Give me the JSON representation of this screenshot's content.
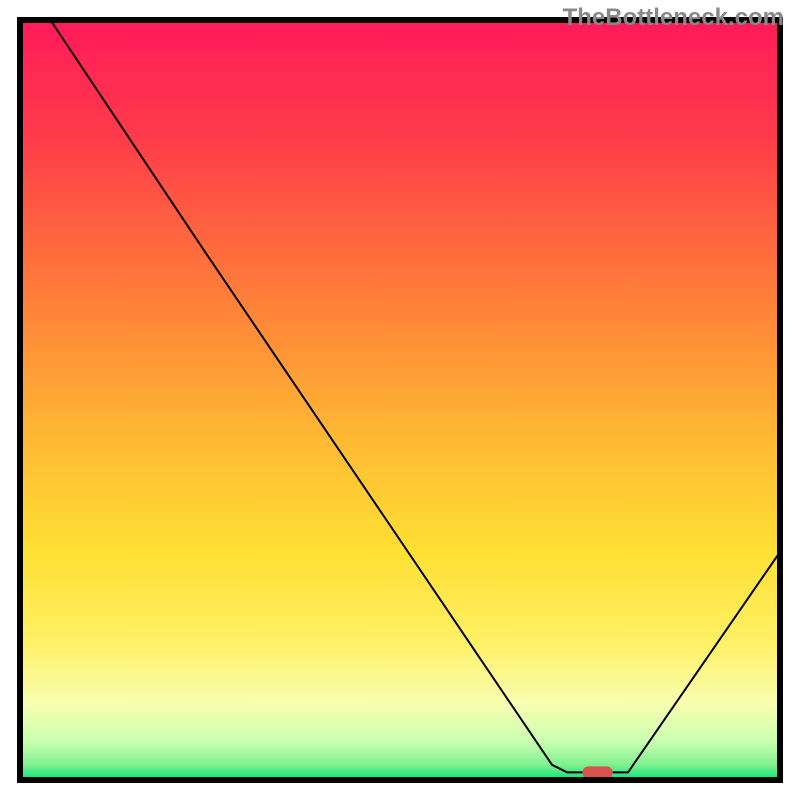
{
  "watermark": "TheBottleneck.com",
  "chart_data": {
    "type": "line",
    "title": "",
    "xlabel": "",
    "ylabel": "",
    "xlim": [
      0,
      100
    ],
    "ylim": [
      0,
      100
    ],
    "gradient_colors": {
      "top": "#ff1a5a",
      "upper_mid": "#ff7a3a",
      "mid": "#ffcc33",
      "lower_mid": "#fff066",
      "lower": "#e8ffb0",
      "bottom": "#00e676"
    },
    "series": [
      {
        "name": "bottleneck-curve",
        "color": "#000000",
        "stroke_width": 2,
        "points": [
          {
            "x": 4,
            "y": 100
          },
          {
            "x": 24,
            "y": 70
          },
          {
            "x": 70,
            "y": 2
          },
          {
            "x": 72,
            "y": 1
          },
          {
            "x": 80,
            "y": 1
          },
          {
            "x": 100,
            "y": 30
          }
        ]
      }
    ],
    "marker": {
      "x": 76,
      "y": 1,
      "color": "#d9534f",
      "width": 4,
      "height": 2
    },
    "frame_color": "#000000",
    "frame_width": 5
  }
}
